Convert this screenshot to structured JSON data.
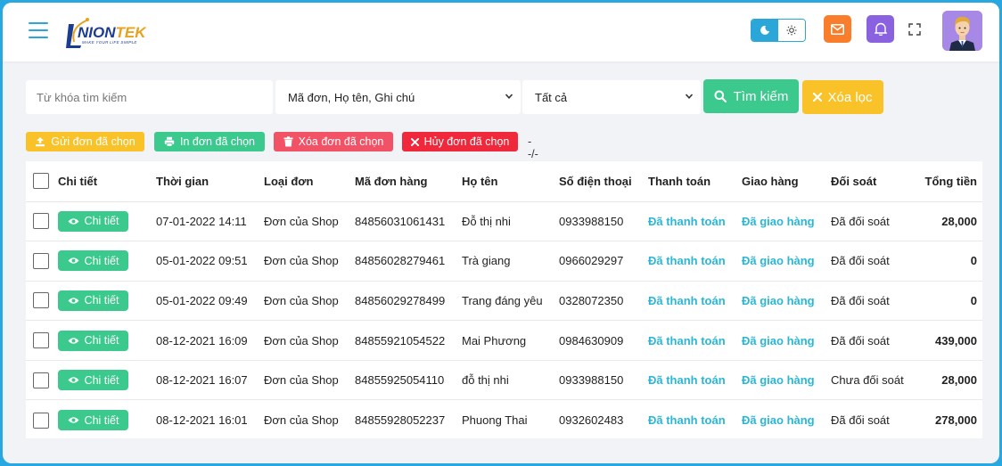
{
  "header": {
    "logo_text_a": "NION",
    "logo_text_b": "TEK",
    "logo_tagline": "MAKE YOUR LIFE SIMPLE"
  },
  "filters": {
    "keyword_placeholder": "Từ khóa tìm kiếm",
    "search_field": "Mã đơn, Họ tên, Ghi chú",
    "status_filter": "Tất cả",
    "search_button": "Tìm kiếm",
    "clear_button": "Xóa lọc"
  },
  "actions": {
    "send": "Gửi đơn đã chọn",
    "print": "In đơn đã chọn",
    "delete": "Xóa đơn đã chọn",
    "cancel": "Hủy đơn đã chọn",
    "date_range": "--/--"
  },
  "table": {
    "headers": [
      "Chi tiết",
      "Thời gian",
      "Loại đơn",
      "Mã đơn hàng",
      "Họ tên",
      "Số điện thoại",
      "Thanh toán",
      "Giao hàng",
      "Đối soát",
      "Tổng tiền"
    ],
    "detail_label": "Chi tiết",
    "rows": [
      {
        "time": "07-01-2022 14:11",
        "type": "Đơn của Shop",
        "code": "84856031061431",
        "name": "Đỗ thị nhi",
        "phone": "0933988150",
        "payment": "Đã thanh toán",
        "delivery": "Đã giao hàng",
        "reconcile": "Đã đối soát",
        "total": "28,000"
      },
      {
        "time": "05-01-2022 09:51",
        "type": "Đơn của Shop",
        "code": "84856028279461",
        "name": "Trà giang",
        "phone": "0966029297",
        "payment": "Đã thanh toán",
        "delivery": "Đã giao hàng",
        "reconcile": "Đã đối soát",
        "total": "0"
      },
      {
        "time": "05-01-2022 09:49",
        "type": "Đơn của Shop",
        "code": "84856029278499",
        "name": "Trang đáng yêu",
        "phone": "0328072350",
        "payment": "Đã thanh toán",
        "delivery": "Đã giao hàng",
        "reconcile": "Đã đối soát",
        "total": "0"
      },
      {
        "time": "08-12-2021 16:09",
        "type": "Đơn của Shop",
        "code": "84855921054522",
        "name": "Mai Phương",
        "phone": "0984630909",
        "payment": "Đã thanh toán",
        "delivery": "Đã giao hàng",
        "reconcile": "Đã đối soát",
        "total": "439,000"
      },
      {
        "time": "08-12-2021 16:07",
        "type": "Đơn của Shop",
        "code": "84855925054110",
        "name": "đỗ thị nhi",
        "phone": "0933988150",
        "payment": "Đã thanh toán",
        "delivery": "Đã giao hàng",
        "reconcile": "Chưa đối soát",
        "total": "28,000"
      },
      {
        "time": "08-12-2021 16:01",
        "type": "Đơn của Shop",
        "code": "84855928052237",
        "name": "Phuong Thai",
        "phone": "0932602483",
        "payment": "Đã thanh toán",
        "delivery": "Đã giao hàng",
        "reconcile": "Đã đối soát",
        "total": "278,000"
      }
    ]
  },
  "colors": {
    "accent": "#2aa7d8",
    "success": "#3cc98d",
    "warning": "#f8c228",
    "danger": "#f25266",
    "danger_strong": "#f0283c",
    "mail": "#f97d2a",
    "bell": "#8a62e0",
    "status_link": "#2bb6d6"
  },
  "icons": {
    "menu": "hamburger-menu-icon",
    "theme_dark": "moon-icon",
    "theme_light": "sun-icon",
    "mail": "mail-icon",
    "bell": "bell-icon",
    "fullscreen": "fullscreen-icon",
    "search": "search-icon",
    "clear": "x-icon",
    "upload": "upload-icon",
    "print": "printer-icon",
    "trash": "trash-icon",
    "eye": "eye-icon"
  }
}
